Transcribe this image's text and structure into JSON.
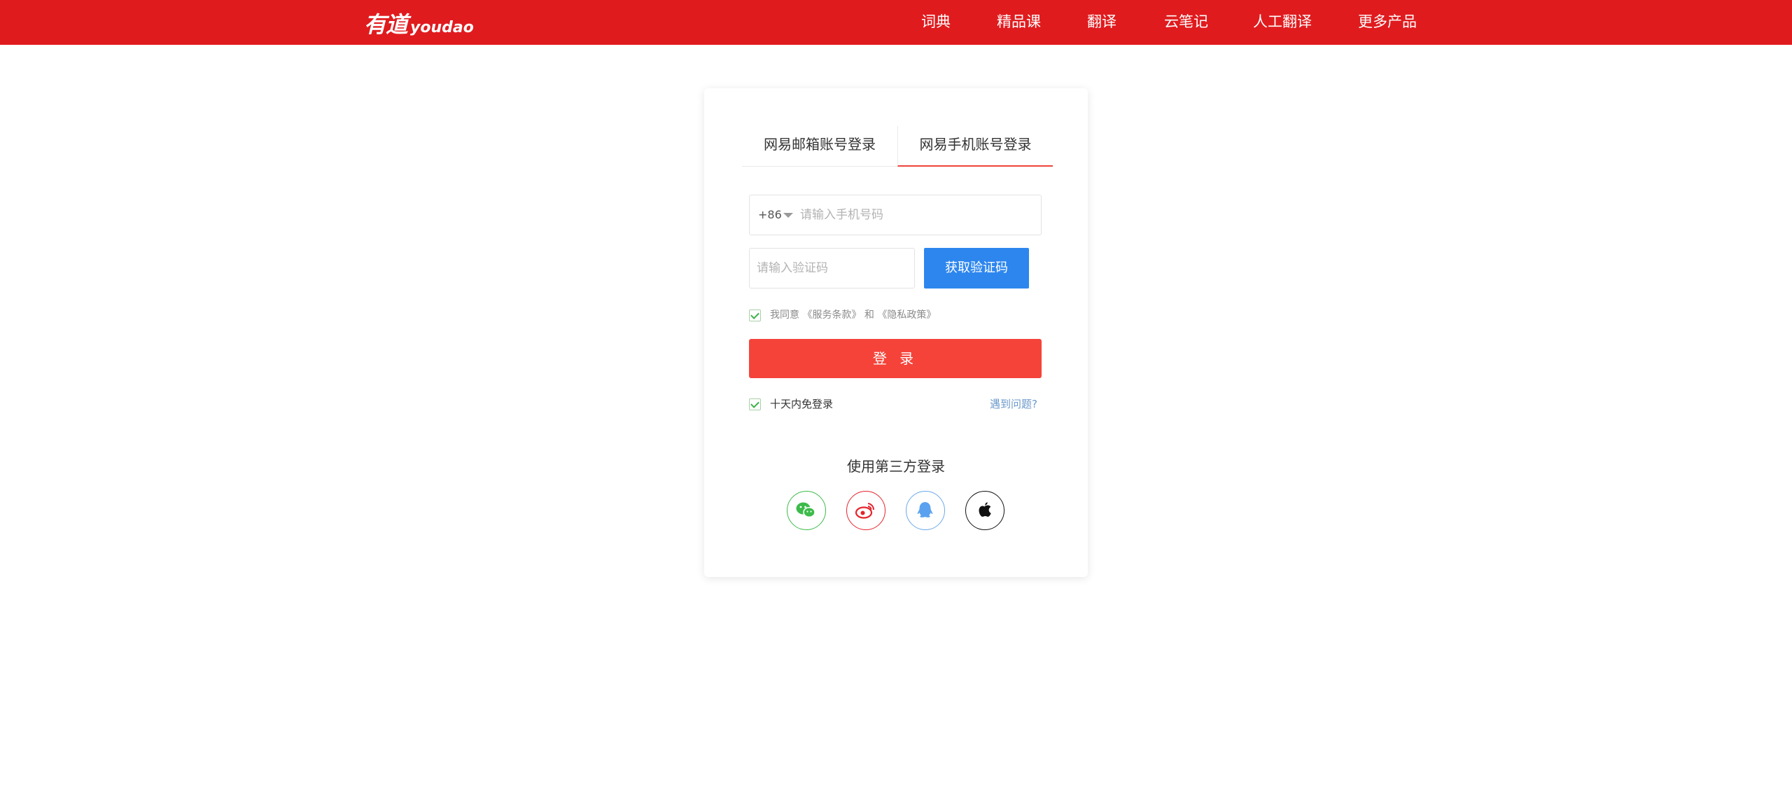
{
  "brand": {
    "logo_cn": "有道",
    "logo_en": "youdao"
  },
  "nav": {
    "items": [
      "词典",
      "精品课",
      "翻译",
      "云笔记",
      "人工翻译",
      "更多产品"
    ]
  },
  "login": {
    "tabs": [
      {
        "label": "网易邮箱账号登录",
        "active": false
      },
      {
        "label": "网易手机账号登录",
        "active": true
      }
    ],
    "country_code": "+86",
    "phone_placeholder": "请输入手机号码",
    "code_placeholder": "请输入验证码",
    "get_code_label": "获取验证码",
    "agree_prefix": "我同意",
    "terms_link": "《服务条款》",
    "agree_and": "和",
    "privacy_link": "《隐私政策》",
    "agree_checked": true,
    "login_label": "登 录",
    "remember_label": "十天内免登录",
    "remember_checked": true,
    "problem_link": "遇到问题?"
  },
  "third_party": {
    "title": "使用第三方登录",
    "providers": [
      "wechat-icon",
      "weibo-icon",
      "qq-icon",
      "apple-icon"
    ]
  },
  "colors": {
    "topbar": "#e01b1e",
    "login_button": "#f5433a",
    "sms_button": "#2d86ee",
    "active_tab_underline": "#f0433b"
  }
}
